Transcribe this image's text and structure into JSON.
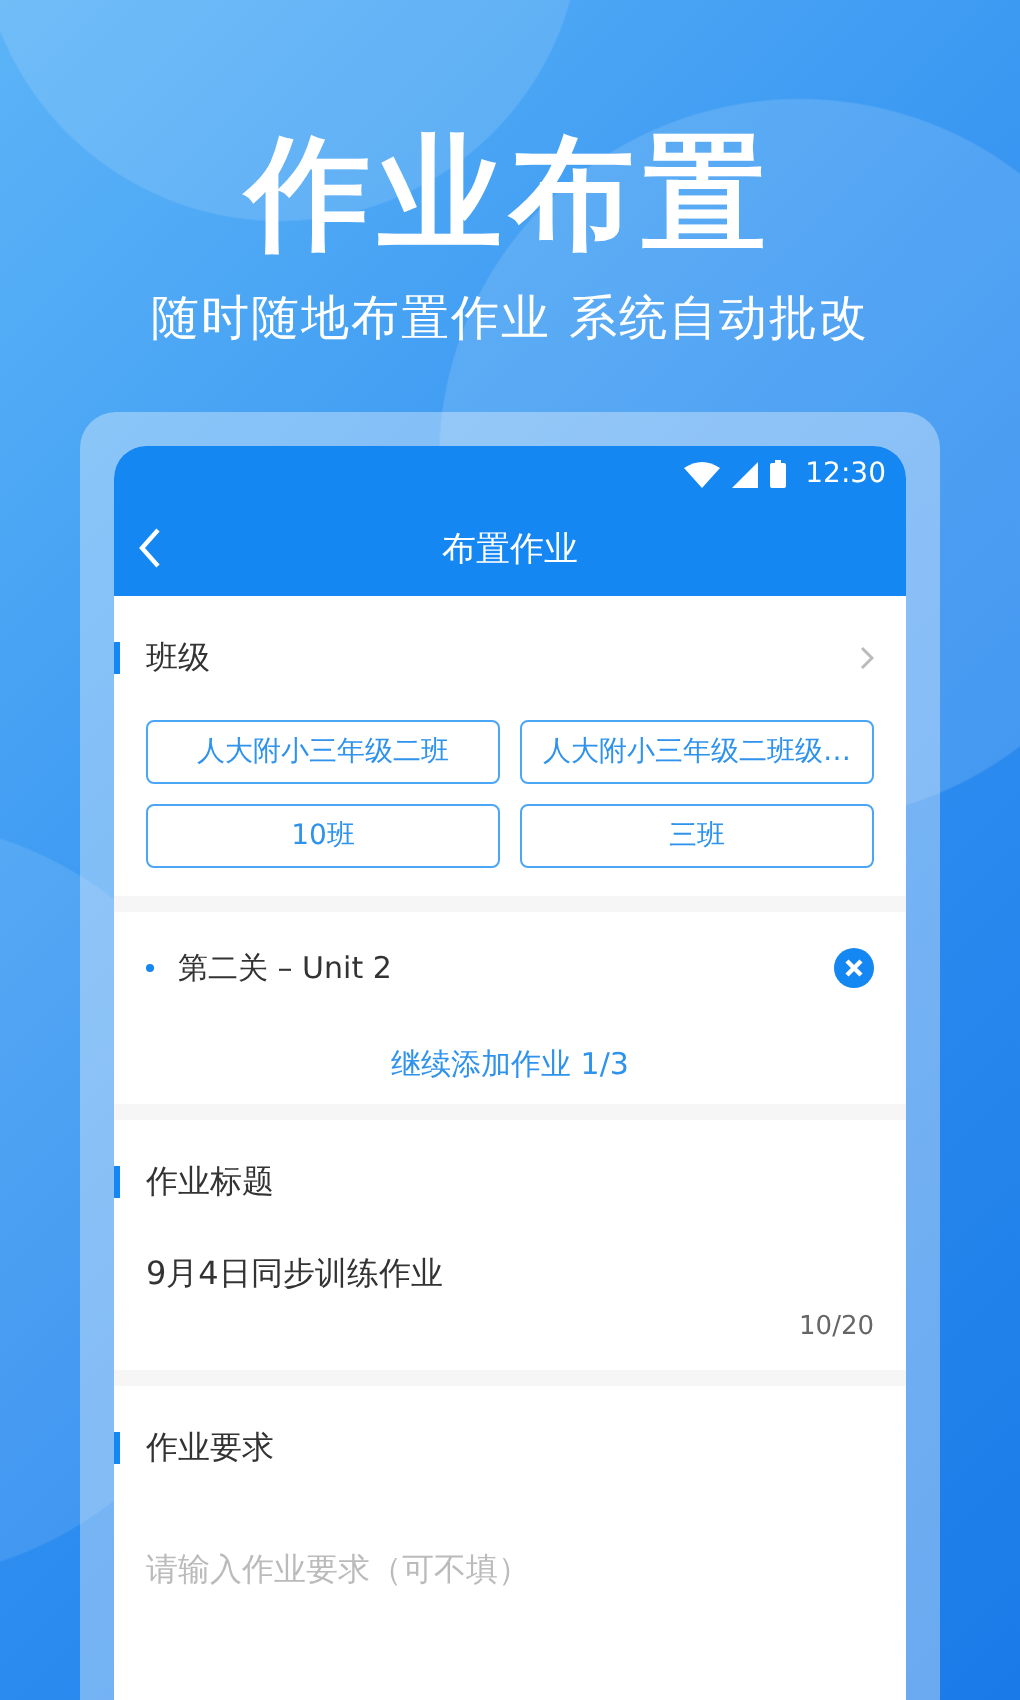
{
  "headline": "作业布置",
  "tagline": "随时随地布置作业 系统自动批改",
  "status_bar": {
    "time": "12:30"
  },
  "app_bar": {
    "title": "布置作业"
  },
  "class_section": {
    "label": "班级",
    "chips": [
      "人大附小三年级二班",
      "人大附小三年级二班级…",
      "10班",
      "三班"
    ]
  },
  "assignment_section": {
    "items": [
      {
        "name": "第二关 – Unit 2"
      }
    ],
    "add_link": "继续添加作业 1/3"
  },
  "title_section": {
    "label": "作业标题",
    "value": "9月4日同步训练作业",
    "counter": "10/20"
  },
  "requirement_section": {
    "label": "作业要求",
    "placeholder": "请输入作业要求（可不填）"
  }
}
